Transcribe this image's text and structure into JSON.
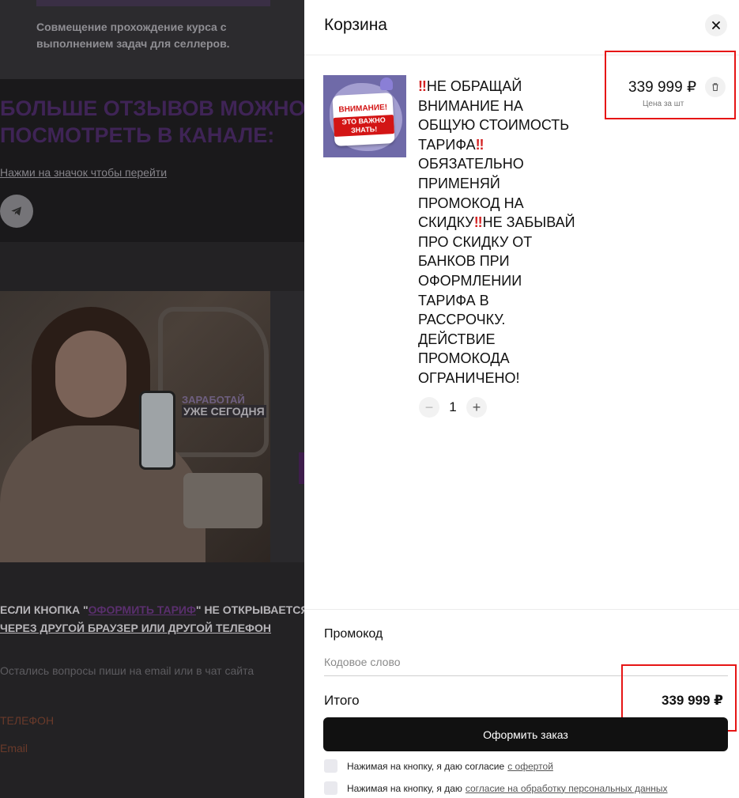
{
  "background": {
    "course_text": "Совмещение прохождение курса с выполнением задач для селлеров.",
    "reviews_title_line1": "БОЛЬШЕ ОТЗЫВОВ МОЖНО",
    "reviews_title_line2": "ПОСМОТРЕТЬ В КАНАЛЕ:",
    "click_link": "Нажми на значок чтобы перейти",
    "photo_label_top": "ЗАРАБОТАЙ",
    "photo_label_bottom": "УЖЕ СЕГОДНЯ",
    "notice_part1": "ЕСЛИ КНОПКА \"",
    "notice_link": "ОФОРМИТЬ ТАРИФ",
    "notice_part2": "\" НЕ ОТКРЫВАЕТСЯ",
    "notice_line2": "ЧЕРЕЗ ДРУГОЙ БРАУЗЕР ИЛИ ДРУГОЙ ТЕЛЕФОН",
    "questions": "Остались вопросы пиши на email или в чат сайта",
    "phone_label": "ТЕЛЕФОН",
    "email_label": "Email"
  },
  "cart": {
    "title": "Корзина",
    "close_icon": "close-icon",
    "item": {
      "thumb_line1": "ВНИМАНИЕ!",
      "thumb_line2": "ЭТО ВАЖНО ЗНАТЬ!",
      "name_mark1": "‼",
      "name_part1": "НЕ ОБРАЩАЙ ВНИМАНИЕ НА ОБЩУЮ СТОИМОСТЬ ТАРИФА",
      "name_mark2": "‼",
      "name_part2": "ОБЯЗАТЕЛЬНО ПРИМЕНЯЙ ПРОМОКОД НА СКИДКУ",
      "name_mark3": "‼",
      "name_part3": "НЕ ЗАБЫВАЙ ПРО СКИДКУ ОТ БАНКОВ ПРИ ОФОРМЛЕНИИ ТАРИФА В РАССРОЧКУ. ДЕЙСТВИЕ ПРОМОКОДА ОГРАНИЧЕНО!",
      "quantity": "1",
      "minus": "−",
      "plus": "+",
      "price": "339 999 ₽",
      "price_sub": "Цена за шт"
    },
    "promo": {
      "label": "Промокод",
      "placeholder": "Кодовое слово"
    },
    "total": {
      "label": "Итого",
      "value": "339 999 ₽"
    },
    "order_button": "Оформить заказ",
    "consent1": {
      "text": "Нажимая на кнопку, я даю согласие",
      "link": "с офертой"
    },
    "consent2": {
      "text": "Нажимая на кнопку, я даю",
      "link": "согласие на обработку персональных данных"
    },
    "highlight_color": "#e61515"
  }
}
